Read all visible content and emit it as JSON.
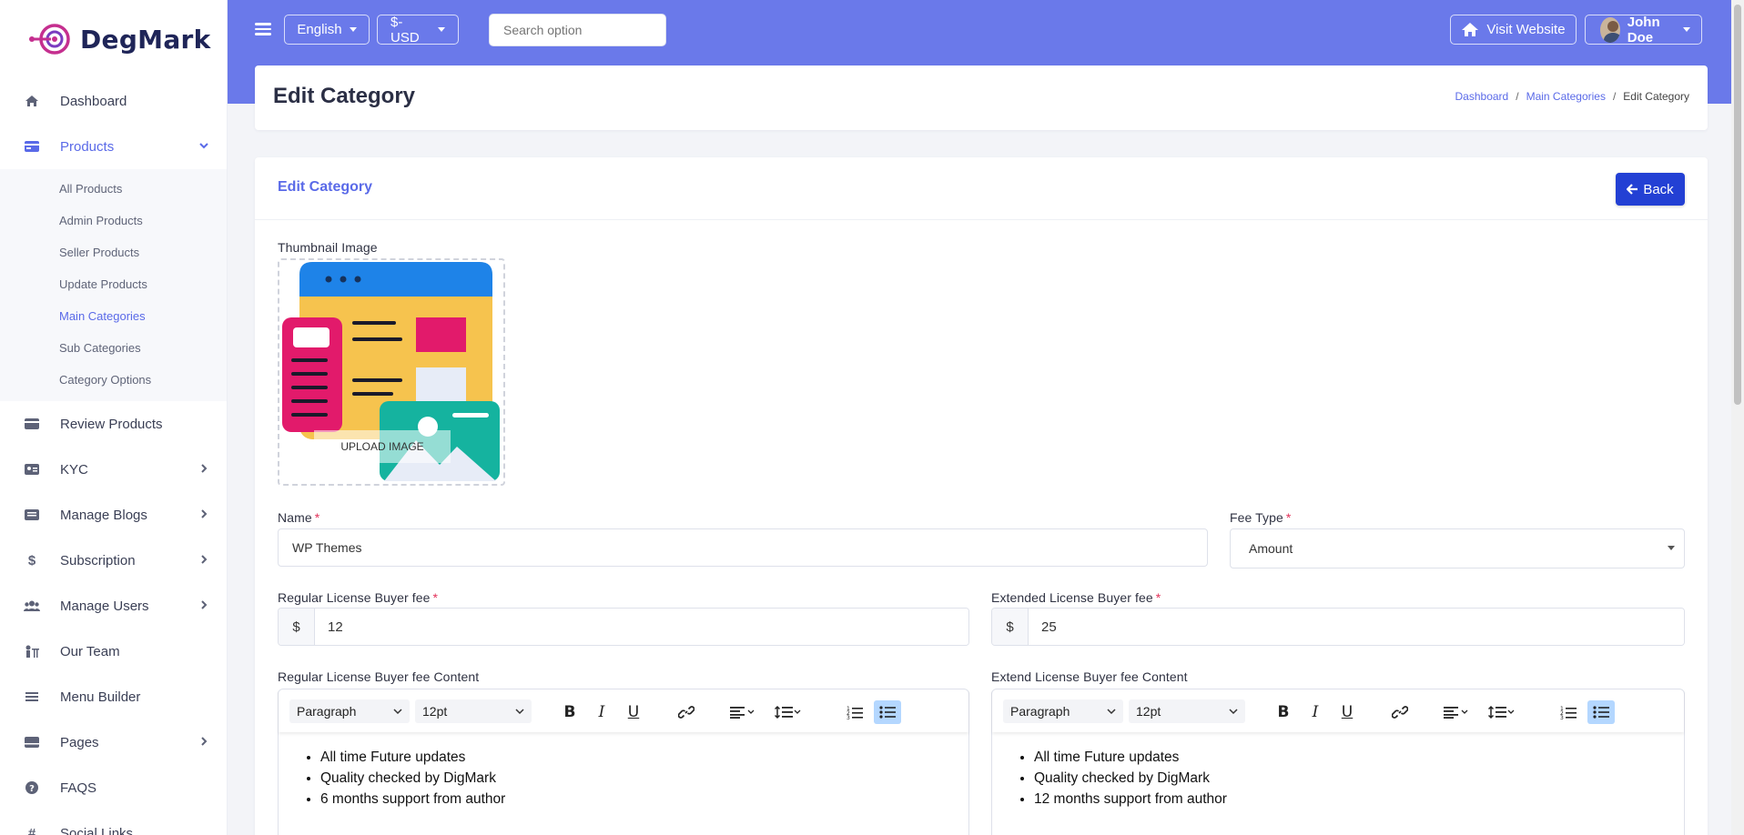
{
  "brand": {
    "name": "DegMark",
    "accent": "#6a79ea"
  },
  "sidebar": {
    "items": [
      {
        "label": "Dashboard",
        "icon": "home-icon"
      },
      {
        "label": "Products",
        "icon": "card-icon"
      },
      {
        "label": "Review Products",
        "icon": "card-icon"
      },
      {
        "label": "KYC",
        "icon": "id-card-icon"
      },
      {
        "label": "Manage Blogs",
        "icon": "blog-icon"
      },
      {
        "label": "Subscription",
        "icon": "dollar-icon"
      },
      {
        "label": "Manage Users",
        "icon": "users-icon"
      },
      {
        "label": "Our Team",
        "icon": "team-icon"
      },
      {
        "label": "Menu Builder",
        "icon": "menu-icon"
      },
      {
        "label": "Pages",
        "icon": "pages-icon"
      },
      {
        "label": "FAQS",
        "icon": "question-icon"
      },
      {
        "label": "Social Links",
        "icon": "hash-icon"
      }
    ],
    "products_sub": [
      "All Products",
      "Admin Products",
      "Seller Products",
      "Update Products",
      "Main Categories",
      "Sub Categories",
      "Category Options"
    ]
  },
  "topbar": {
    "language": "English",
    "currency": "$-USD",
    "search_placeholder": "Search option",
    "visit_website": "Visit Website",
    "user_name": "John Doe"
  },
  "page": {
    "title": "Edit Category",
    "breadcrumb": [
      "Dashboard",
      "Main Categories",
      "Edit Category"
    ]
  },
  "form": {
    "card_title": "Edit Category",
    "back_label": "Back",
    "thumbnail_label": "Thumbnail Image",
    "upload_label": "UPLOAD IMAGE",
    "name_label": "Name",
    "name_value": "WP Themes",
    "fee_type_label": "Fee Type",
    "fee_type_value": "Amount",
    "regular_fee_label": "Regular License Buyer fee",
    "regular_fee_currency": "$",
    "regular_fee_value": "12",
    "extended_fee_label": "Extended License Buyer fee",
    "extended_fee_currency": "$",
    "extended_fee_value": "25",
    "regular_content_label": "Regular License Buyer fee Content",
    "extend_content_label": "Extend License Buyer fee Content",
    "required_mark": "*"
  },
  "editor": {
    "block_format": "Paragraph",
    "font_size": "12pt",
    "regular_items": [
      "All time Future updates",
      "Quality checked by DigMark",
      "6 months support from author"
    ],
    "extended_items": [
      "All time Future updates",
      "Quality checked by DigMark",
      "12 months support from author"
    ]
  }
}
